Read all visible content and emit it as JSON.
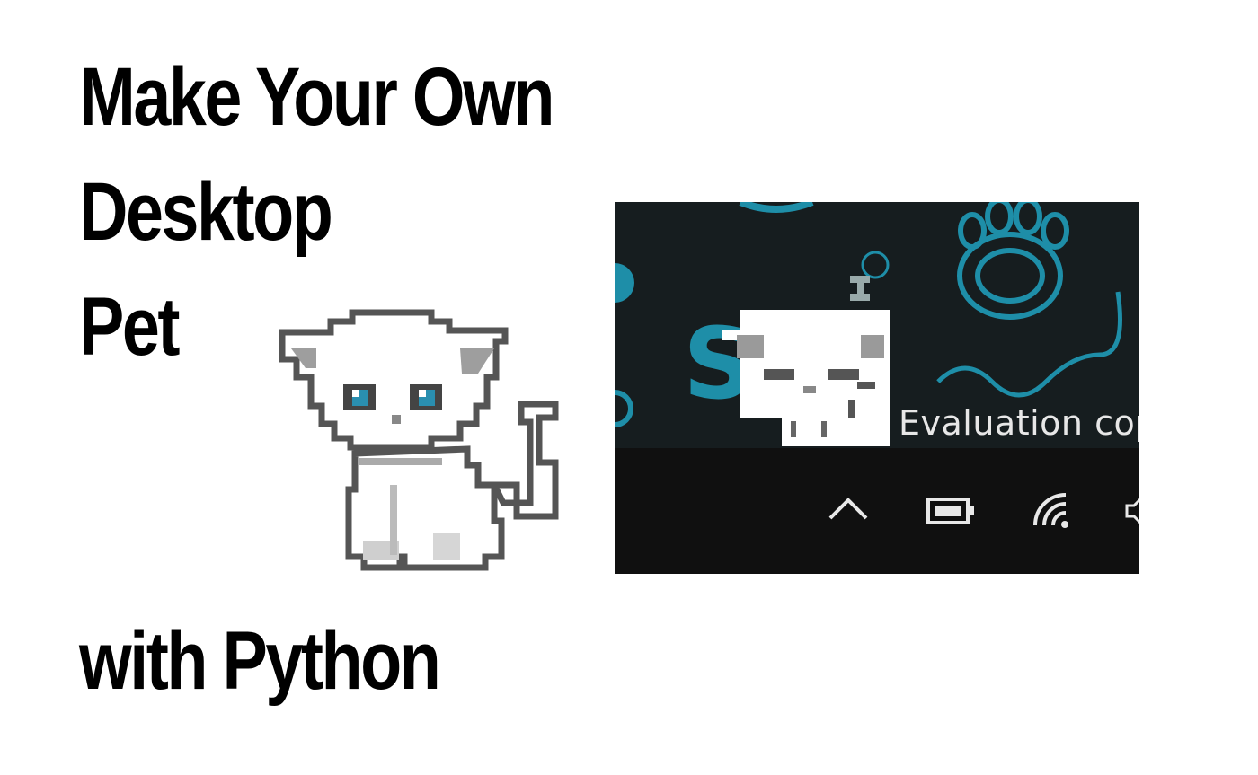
{
  "title": {
    "line1": "Make Your Own",
    "line2": "Desktop",
    "line3": "Pet",
    "line4": "with Python"
  },
  "illustration": {
    "subject": "pixel-art white cat",
    "eye_color": "#2a8fb0",
    "outline_color": "#555555",
    "shade_color": "#a9a9a9"
  },
  "screenshot": {
    "watermark": "Evaluation cop",
    "desktop_color": "#161d1f",
    "accent_color": "#1e8ea8",
    "taskbar_color": "#101010",
    "tray_icons": [
      "chevron-up-icon",
      "battery-icon",
      "wifi-icon",
      "speaker-icon"
    ]
  }
}
